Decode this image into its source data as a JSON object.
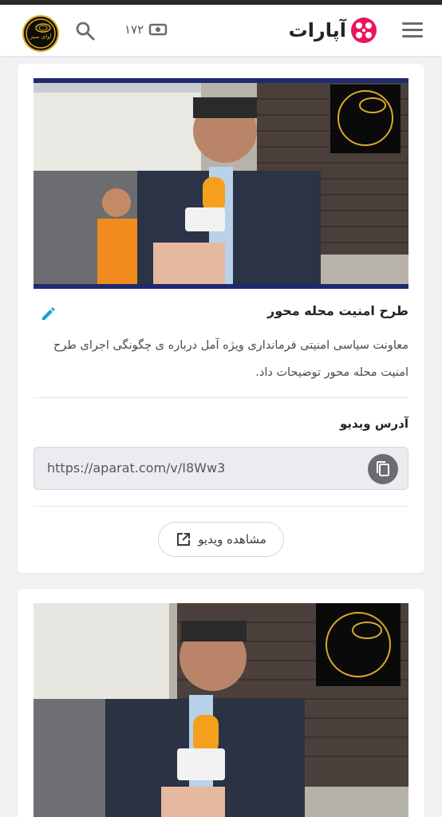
{
  "header": {
    "logo_text": "آپارات",
    "views_count": "۱۷۲",
    "icons": [
      "menu-icon",
      "aparat-logo-icon",
      "video-count-icon",
      "search-icon",
      "channel-avatar"
    ]
  },
  "video_card": {
    "title": "طرح امنیت محله محور",
    "description": "معاونت سیاسی امنیتی فرمانداری ویژه آمل درباره ی چگونگی اجرای طرح امنیت محله محور توضیحات داد.",
    "address_label": "آدرس ویدیو",
    "url": "https://aparat.com/v/I8Ww3",
    "watch_label": "مشاهده ویدیو",
    "colors": {
      "accent": "#1f9bd9",
      "frame": "#1f2b6e",
      "brand": "#ed145b"
    }
  },
  "channel_logo_text": "آوای سبز"
}
